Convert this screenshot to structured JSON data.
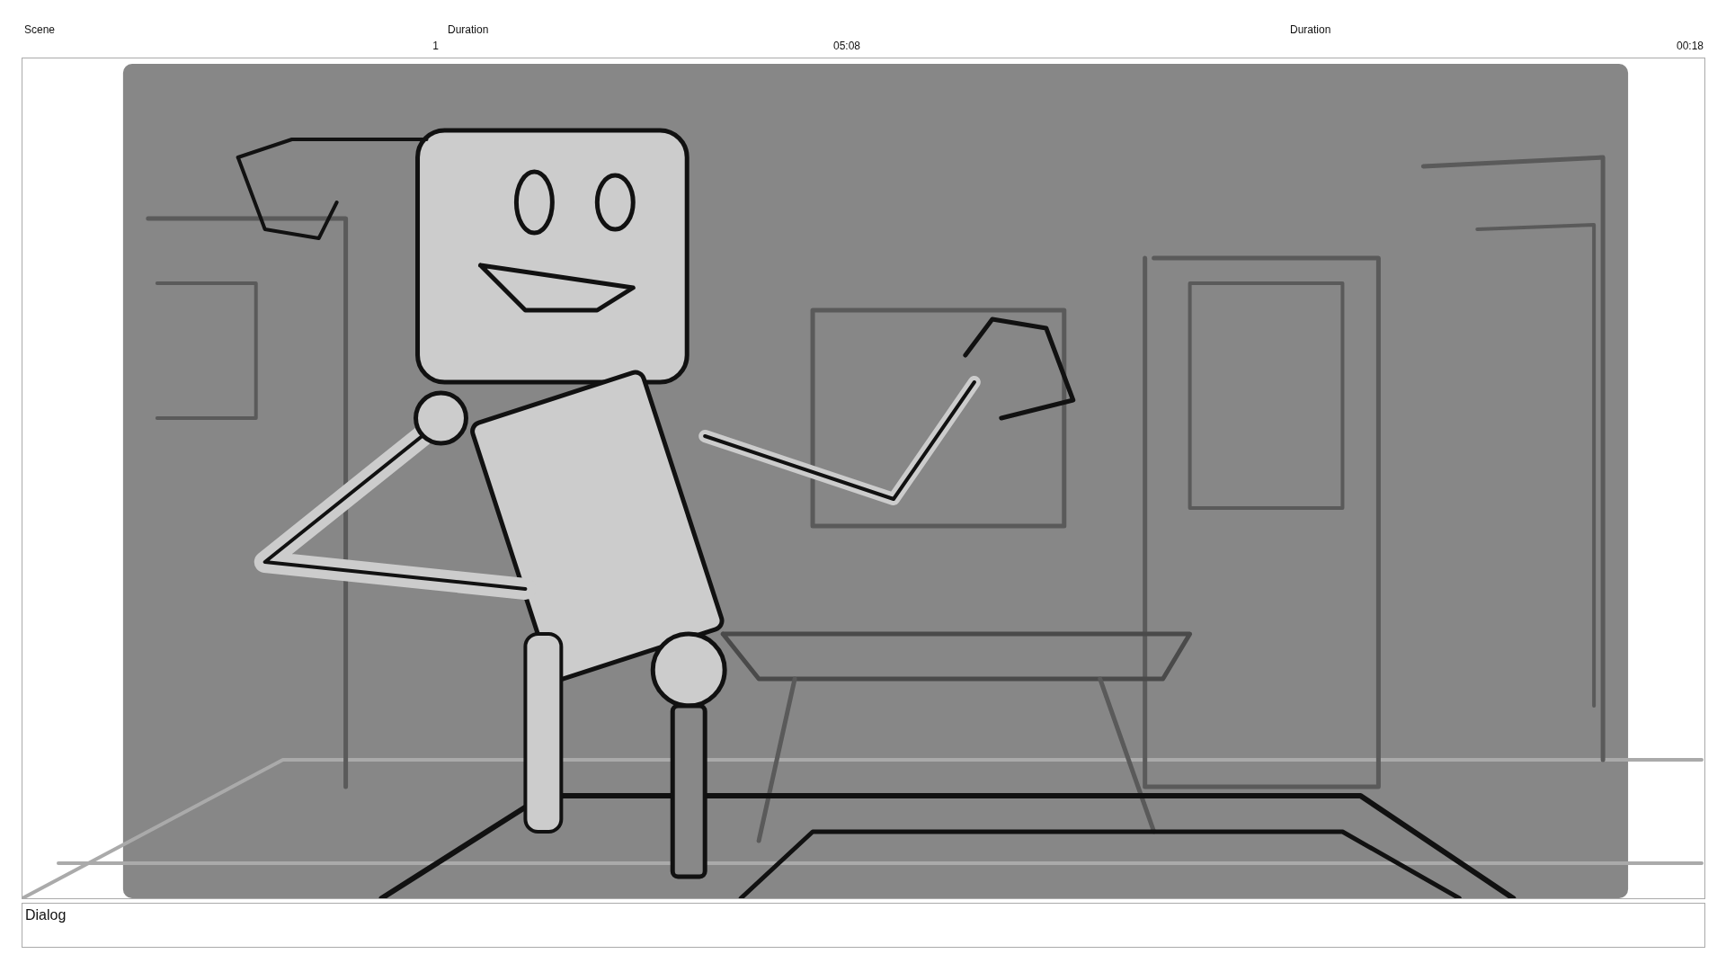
{
  "header": {
    "scene_label": "Scene",
    "scene_value": "1",
    "duration_label_1": "Duration",
    "duration_value_1": "05:08",
    "duration_label_2": "Duration",
    "duration_value_2": "00:18"
  },
  "dialog": {
    "label": "Dialog"
  }
}
